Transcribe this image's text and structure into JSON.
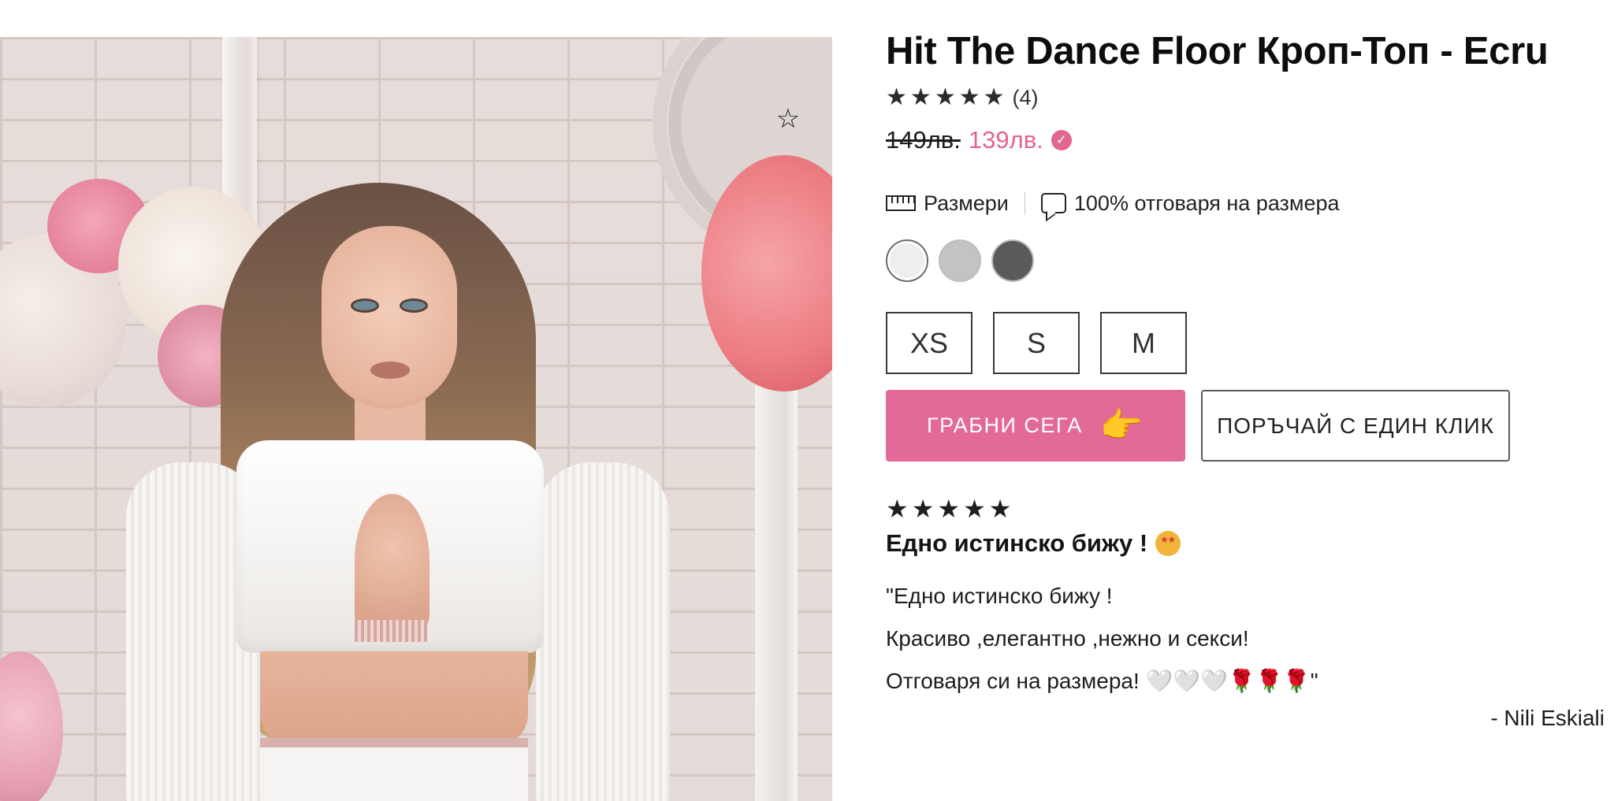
{
  "product": {
    "title": "Hit The Dance Floor Кроп-Топ - Ecru",
    "rating": {
      "stars": 5,
      "count_label": "(4)"
    },
    "price": {
      "old": "149лв.",
      "new": "139лв.",
      "verified_icon": "verified-check-icon"
    },
    "wishlist_icon": "star-outline-icon"
  },
  "size_info": {
    "sizes_link": "Размери",
    "fit_label": "100% отговаря на размера",
    "ruler_icon": "ruler-icon",
    "chat_icon": "speech-bubble-icon"
  },
  "colors": [
    {
      "name": "ecru",
      "hex": "#efeded",
      "selected": true
    },
    {
      "name": "light-grey",
      "hex": "#c3c3c3",
      "selected": false
    },
    {
      "name": "dark-grey",
      "hex": "#5a5a5a",
      "selected": false
    }
  ],
  "sizes": [
    "XS",
    "S",
    "M"
  ],
  "actions": {
    "buy_now": "ГРАБНИ СЕГА",
    "buy_now_icon": "👉",
    "one_click": "ПОРЪЧАЙ С ЕДИН КЛИК"
  },
  "review": {
    "stars": 5,
    "title": "Едно истинско бижу !",
    "lines": [
      "\"Едно истинско бижу !",
      "Красиво ,елегантно ,нежно и секси!",
      "Отговаря си на размера! 🤍🤍🤍🌹🌹🌹\""
    ],
    "author": "- Nili Eskiali"
  },
  "colors_theme": {
    "accent_pink": "#e36a98",
    "price_pink": "#e26592",
    "text": "#1c1c1c"
  }
}
